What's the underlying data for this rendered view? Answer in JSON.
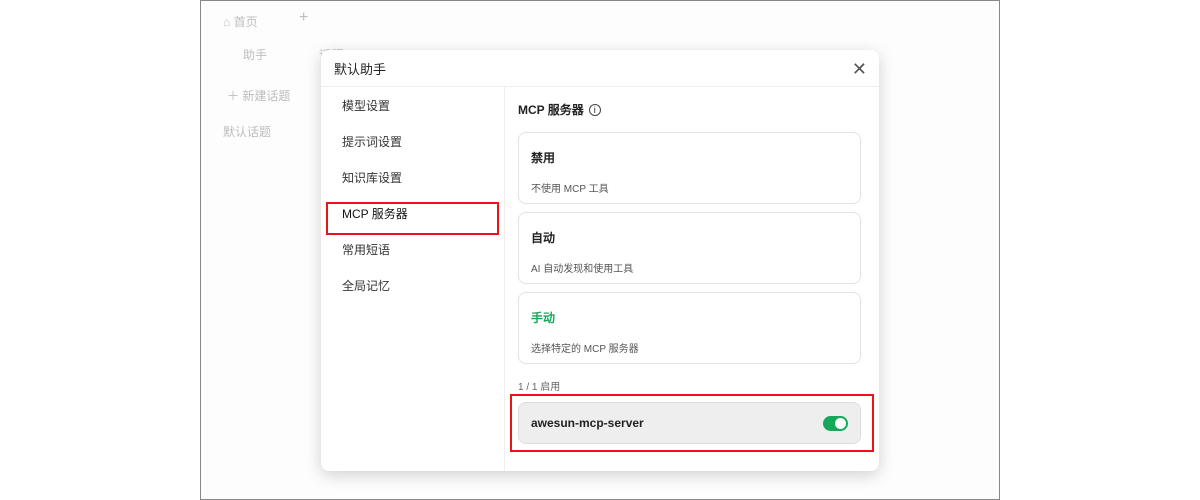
{
  "background": {
    "tab_home": "首页",
    "tab_add": "+",
    "tab_assistant": "助手",
    "tab_topic": "话题",
    "new_topic": "新建话题",
    "default_topic": "默认话题"
  },
  "modal": {
    "title": "默认助手",
    "close": "✕",
    "nav": [
      {
        "label": "模型设置"
      },
      {
        "label": "提示词设置"
      },
      {
        "label": "知识库设置"
      },
      {
        "label": "MCP 服务器",
        "active": true
      },
      {
        "label": "常用短语"
      },
      {
        "label": "全局记忆"
      }
    ],
    "section_title": "MCP 服务器",
    "info_icon": "i",
    "modes": [
      {
        "title": "禁用",
        "desc": "不使用 MCP 工具"
      },
      {
        "title": "自动",
        "desc": "AI 自动发现和使用工具"
      },
      {
        "title": "手动",
        "desc": "选择特定的 MCP 服务器",
        "selected": true
      }
    ],
    "enabled_count": "1 / 1 启用",
    "servers": [
      {
        "name": "awesun-mcp-server",
        "enabled": true
      }
    ]
  },
  "colors": {
    "accent": "#16a85a",
    "highlight": "#e8141a"
  }
}
